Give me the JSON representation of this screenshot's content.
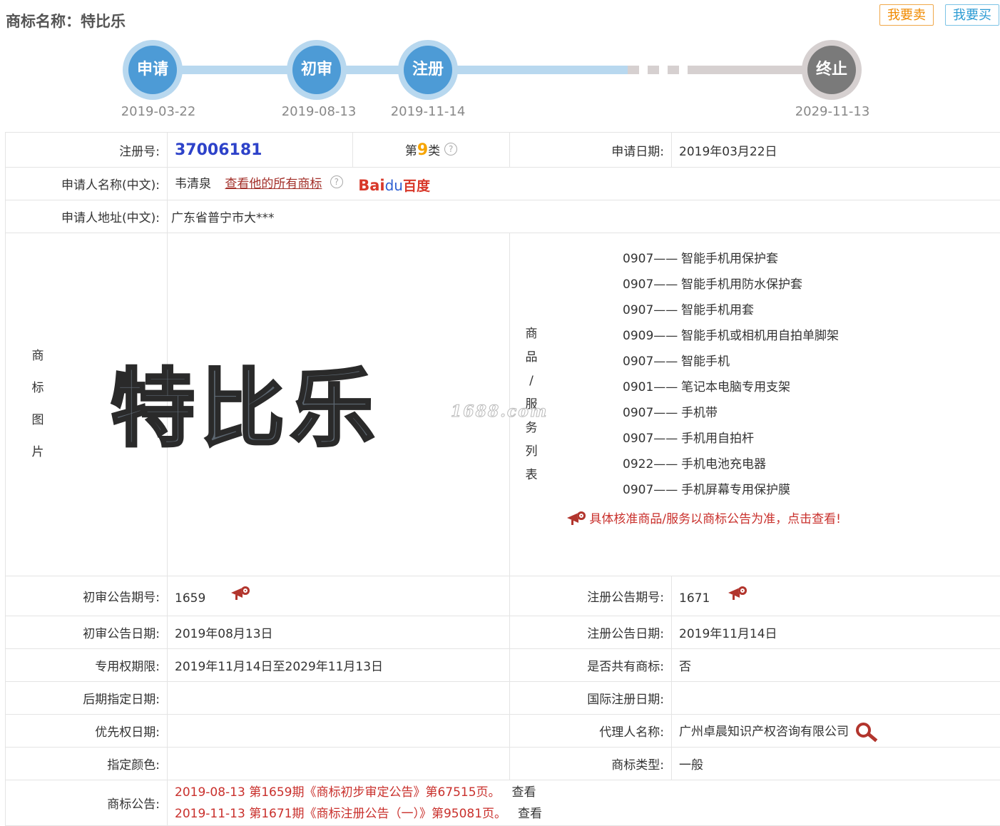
{
  "header": {
    "title": "商标名称：特比乐",
    "sell_label": "我要卖",
    "buy_label": "我要买"
  },
  "timeline": [
    {
      "label": "申请",
      "date": "2019-03-22"
    },
    {
      "label": "初审",
      "date": "2019-08-13"
    },
    {
      "label": "注册",
      "date": "2019-11-14"
    },
    {
      "label": "终止",
      "date": "2029-11-13"
    }
  ],
  "info": {
    "reg_no_label": "注册号:",
    "reg_no": "37006181",
    "class_prefix": "第",
    "class_num": "9",
    "class_suffix": "类",
    "apply_date_label": "申请日期:",
    "apply_date": "2019年03月22日",
    "applicant_label": "申请人名称(中文):",
    "applicant": "韦清泉",
    "all_marks_link": "查看他的所有商标",
    "baidu_b1": "Bai",
    "baidu_paw": "du",
    "baidu_b2": "百度",
    "address_label": "申请人地址(中文):",
    "address": "广东省普宁市大***",
    "image_label": [
      "商",
      "标",
      "图",
      "片"
    ],
    "mark_text": "特比乐",
    "goods_label": [
      "商",
      "品",
      "/",
      "服",
      "务",
      "列",
      "表"
    ],
    "goods": [
      {
        "code": "0907——",
        "name": "智能手机用保护套"
      },
      {
        "code": "0907——",
        "name": "智能手机用防水保护套"
      },
      {
        "code": "0907——",
        "name": "智能手机用套"
      },
      {
        "code": "0909——",
        "name": "智能手机或相机用自拍单脚架"
      },
      {
        "code": "0907——",
        "name": "智能手机"
      },
      {
        "code": "0901——",
        "name": "笔记本电脑专用支架"
      },
      {
        "code": "0907——",
        "name": "手机带"
      },
      {
        "code": "0907——",
        "name": "手机用自拍杆"
      },
      {
        "code": "0922——",
        "name": "手机电池充电器"
      },
      {
        "code": "0907——",
        "name": "手机屏幕专用保护膜"
      }
    ],
    "goods_notice": "具体核准商品/服务以商标公告为准，点击查看!",
    "watermark": "1688.com",
    "prelim_no_label": "初审公告期号:",
    "prelim_no": "1659",
    "reg_pub_no_label": "注册公告期号:",
    "reg_pub_no": "1671",
    "prelim_date_label": "初审公告日期:",
    "prelim_date": "2019年08月13日",
    "reg_pub_date_label": "注册公告日期:",
    "reg_pub_date": "2019年11月14日",
    "term_label": "专用权期限:",
    "term": "2019年11月14日至2029年11月13日",
    "shared_label": "是否共有商标:",
    "shared": "否",
    "later_date_label": "后期指定日期:",
    "later_date": "",
    "intl_date_label": "国际注册日期:",
    "intl_date": "",
    "priority_label": "优先权日期:",
    "priority": "",
    "agent_label": "代理人名称:",
    "agent": "广州卓晨知识产权咨询有限公司",
    "color_label": "指定颜色:",
    "color": "",
    "type_label": "商标类型:",
    "type": "一般",
    "announce_label": "商标公告:",
    "announcements": [
      {
        "text": "2019-08-13 第1659期《商标初步审定公告》第67515页。",
        "view": "查看"
      },
      {
        "text": "2019-11-13 第1671期《商标注册公告（一）》第95081页。",
        "view": "查看"
      }
    ]
  },
  "colors": {
    "accent_blue": "#4d9bd6",
    "link_red": "#c9302c",
    "reg_no_blue": "#2d42c9",
    "class_orange": "#f6a400"
  }
}
